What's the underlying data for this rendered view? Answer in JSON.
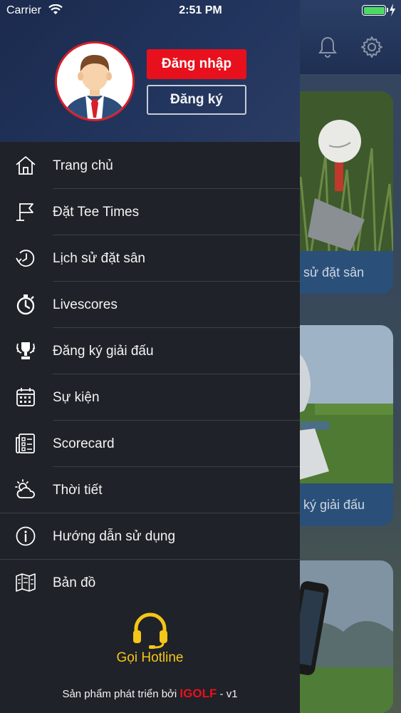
{
  "status_bar": {
    "carrier": "Carrier",
    "time": "2:51 PM"
  },
  "auth": {
    "login_label": "Đăng nhập",
    "register_label": "Đăng ký"
  },
  "menu": [
    {
      "label": "Trang chủ",
      "icon": "home-icon"
    },
    {
      "label": "Đặt Tee Times",
      "icon": "flag-icon"
    },
    {
      "label": "Lịch sử đặt sân",
      "icon": "history-icon"
    },
    {
      "label": "Livescores",
      "icon": "stopwatch-icon"
    },
    {
      "label": "Đăng ký giải đấu",
      "icon": "trophy-icon"
    },
    {
      "label": "Sự kiện",
      "icon": "calendar-icon"
    },
    {
      "label": "Scorecard",
      "icon": "scorecard-icon"
    },
    {
      "label": "Thời tiết",
      "icon": "weather-icon"
    },
    {
      "label": "Hướng dẫn sử dụng",
      "icon": "info-icon"
    },
    {
      "label": "Bản đồ",
      "icon": "map-icon"
    }
  ],
  "hotline": {
    "label": "Gọi Hotline"
  },
  "footer": {
    "prefix": "Sản phẩm phát triển bởi",
    "brand": "IGOLF",
    "suffix": "- v1"
  },
  "background": {
    "card_captions": [
      "sử đặt sân",
      "ký giải đấu"
    ]
  },
  "colors": {
    "accent_red": "#e8101d",
    "hotline_yellow": "#f5c518",
    "drawer_bg": "#1f2228",
    "header_blue": "#1b2a4d",
    "battery_green": "#4cd964"
  }
}
